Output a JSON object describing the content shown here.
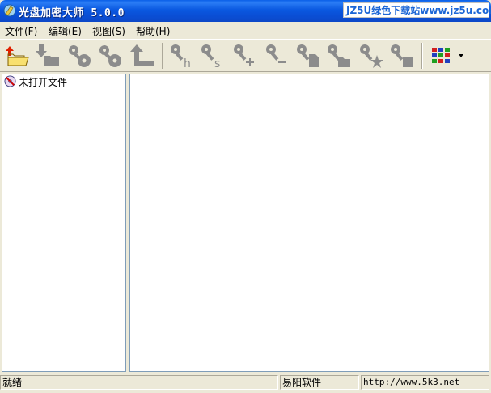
{
  "window": {
    "title": "光盘加密大师 5.0.0",
    "watermark": "JZ5U绿色下载站www.jz5u.com"
  },
  "menu": [
    {
      "label": "文件(F)"
    },
    {
      "label": "编辑(E)"
    },
    {
      "label": "视图(S)"
    },
    {
      "label": "帮助(H)"
    }
  ],
  "toolbar": {
    "buttons": [
      {
        "icon": "open-folder-icon",
        "enabled": true
      },
      {
        "icon": "import-icon",
        "enabled": false
      },
      {
        "icon": "key-disc-icon",
        "enabled": false
      },
      {
        "icon": "key-disc-icon",
        "enabled": false
      },
      {
        "icon": "upload-icon",
        "enabled": false
      },
      {
        "icon": "key-h-icon",
        "enabled": false
      },
      {
        "icon": "key-s-icon",
        "enabled": false
      },
      {
        "icon": "key-plus-icon",
        "enabled": false
      },
      {
        "icon": "key-minus-icon",
        "enabled": false
      },
      {
        "icon": "key-file-icon",
        "enabled": false
      },
      {
        "icon": "key-folder-icon",
        "enabled": false
      },
      {
        "icon": "key-star-icon",
        "enabled": false
      },
      {
        "icon": "key-block-icon",
        "enabled": false
      },
      {
        "icon": "view-grid-icon",
        "enabled": true
      }
    ]
  },
  "tree": {
    "root_label": "未打开文件"
  },
  "status": {
    "state": "就绪",
    "company": "易阳软件",
    "url": "http://www.5k3.net"
  },
  "colors": {
    "titlebar": "#0a58e0",
    "disabled_icon": "#8c8c8c",
    "pane_border": "#7f9db9"
  }
}
